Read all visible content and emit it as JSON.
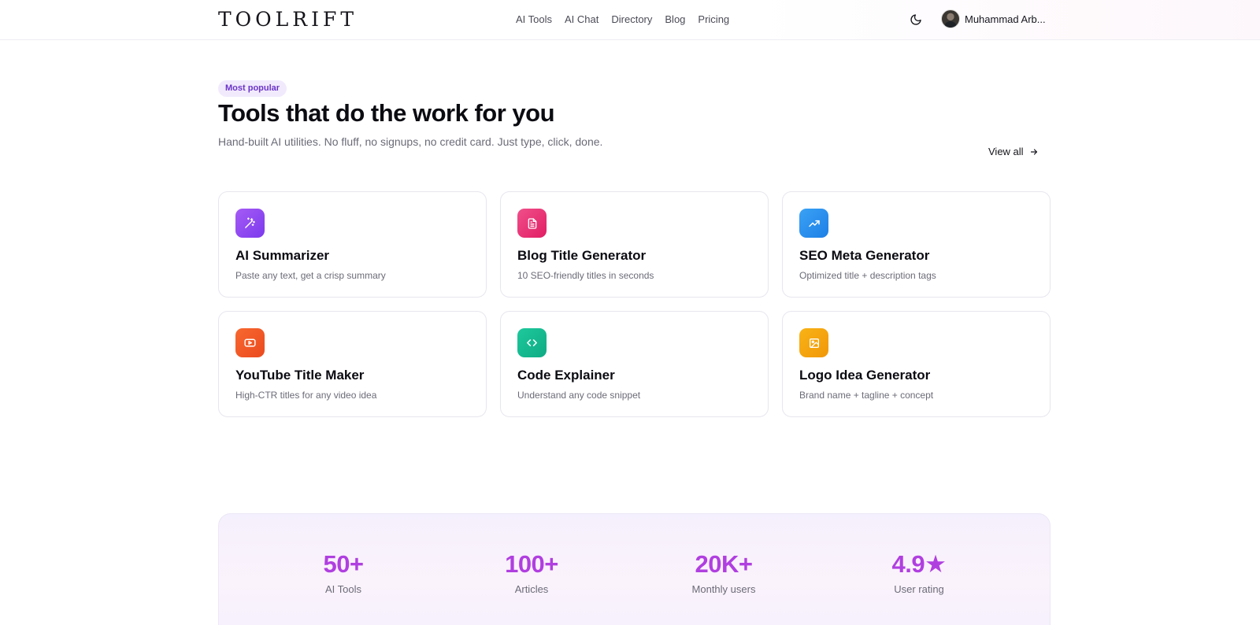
{
  "header": {
    "logo": "TOOLRIFT",
    "nav": [
      "AI Tools",
      "AI Chat",
      "Directory",
      "Blog",
      "Pricing"
    ],
    "theme_icon": "moon-icon",
    "user_name": "Muhammad Arb..."
  },
  "hero": {
    "badge": "Most popular",
    "title": "Tools that do the work for you",
    "subtitle": "Hand-built AI utilities. No fluff, no signups, no credit card. Just type, click, done.",
    "view_all": "View all"
  },
  "tools": [
    {
      "name": "AI Summarizer",
      "desc": "Paste any text, get a crisp summary",
      "icon": "magic-wand-icon",
      "color_from": "#a55bf5",
      "color_to": "#7c3aed"
    },
    {
      "name": "Blog Title Generator",
      "desc": "10 SEO-friendly titles in seconds",
      "icon": "document-icon",
      "color_from": "#f0508a",
      "color_to": "#e11d63"
    },
    {
      "name": "SEO Meta Generator",
      "desc": "Optimized title + description tags",
      "icon": "trending-up-icon",
      "color_from": "#3aa2f5",
      "color_to": "#1d7fe6"
    },
    {
      "name": "YouTube Title Maker",
      "desc": "High-CTR titles for any video idea",
      "icon": "youtube-icon",
      "color_from": "#f8682f",
      "color_to": "#ea4a1f"
    },
    {
      "name": "Code Explainer",
      "desc": "Understand any code snippet",
      "icon": "code-icon",
      "color_from": "#1ec99c",
      "color_to": "#0fab84"
    },
    {
      "name": "Logo Idea Generator",
      "desc": "Brand name + tagline + concept",
      "icon": "image-icon",
      "color_from": "#f8b316",
      "color_to": "#f19708"
    }
  ],
  "stats": [
    {
      "value": "50+",
      "label": "AI Tools"
    },
    {
      "value": "100+",
      "label": "Articles"
    },
    {
      "value": "20K+",
      "label": "Monthly users"
    },
    {
      "value": "4.9★",
      "label": "User rating"
    }
  ]
}
